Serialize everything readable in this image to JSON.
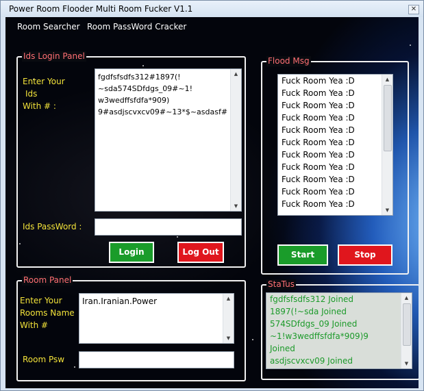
{
  "window": {
    "title": "Power Room Flooder Multi Room Fucker V1.1",
    "close_glyph": "✕"
  },
  "menu": {
    "items": [
      "Room Searcher",
      "Room PassWord Cracker"
    ]
  },
  "ids_panel": {
    "legend": "Ids Login Panel",
    "enter_label": [
      "Enter Your",
      "Ids",
      "With # :"
    ],
    "ids_text": [
      "fgdfsfsdfs312#1897(!",
      "~sda574SDfdgs_09#~1!",
      "w3wedffsfdfa*909)",
      "9#asdjscvxcv09#~13*$~asdasf#"
    ],
    "password_label": "Ids PassWord :",
    "password_value": "",
    "login_label": "Login",
    "logout_label": "Log Out"
  },
  "flood_panel": {
    "legend": "Flood Msg",
    "messages": [
      "Fuck Room Yea :D",
      "Fuck Room Yea :D",
      "Fuck Room Yea :D",
      "Fuck Room Yea :D",
      "Fuck Room Yea :D",
      "Fuck Room Yea :D",
      "Fuck Room Yea :D",
      "Fuck Room Yea :D",
      "Fuck Room Yea :D",
      "Fuck Room Yea :D",
      "Fuck Room Yea :D"
    ],
    "start_label": "Start",
    "stop_label": "Stop"
  },
  "room_panel": {
    "legend": "Room Panel",
    "enter_label": [
      "Enter Your",
      "Rooms Name",
      "With #"
    ],
    "rooms_text": "Iran.Iranian.Power",
    "psw_label": "Room Psw",
    "psw_value": ""
  },
  "status_panel": {
    "legend": "StaTus",
    "lines": [
      "fgdfsfsdfs312 Joined",
      "1897(!~sda Joined",
      "574SDfdgs_09 Joined",
      "~1!w3wedffsfdfa*909)9",
      "Joined",
      "asdjscvxcv09 Joined"
    ]
  },
  "colors": {
    "accent_green": "#1a9c2a",
    "accent_red": "#e0161d",
    "legend_pink": "#ff6f73",
    "label_yellow": "#f3e33a"
  }
}
